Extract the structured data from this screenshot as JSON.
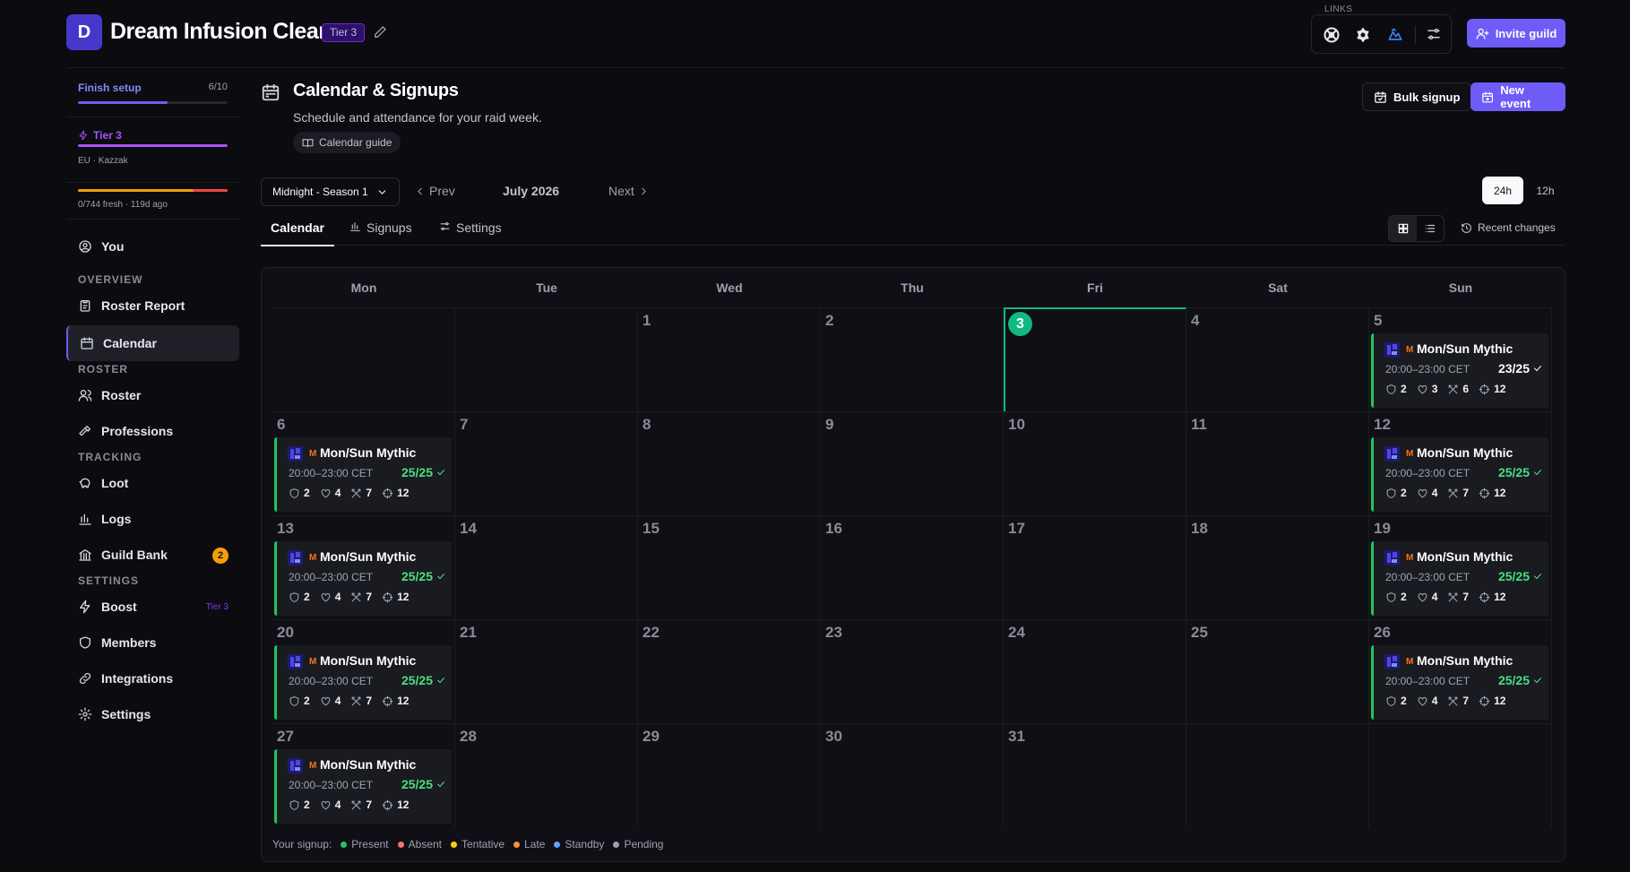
{
  "header": {
    "avatar_letter": "D",
    "guild_name": "Dream Infusion Clean",
    "tier_badge": "Tier 3",
    "links_label": "LINKS",
    "invite_label": "Invite guild",
    "link_icons": [
      "warcraftlogs-icon",
      "raiderio-icon",
      "wowprogress-icon",
      "link-settings-icon"
    ]
  },
  "sidebar": {
    "setup_label": "Finish setup",
    "setup_count": "6/10",
    "setup_progress": 0.6,
    "tier_label": "Tier 3",
    "tier_progress": 1.0,
    "region": "EU · Kazzak",
    "fresh_text": "0/744 fresh · 119d ago",
    "you_label": "You",
    "sections": {
      "overview": "OVERVIEW",
      "roster": "ROSTER",
      "tracking": "TRACKING",
      "settings": "SETTINGS"
    },
    "items": {
      "roster_report": "Roster Report",
      "calendar": "Calendar",
      "roster": "Roster",
      "professions": "Professions",
      "loot": "Loot",
      "logs": "Logs",
      "guild_bank": "Guild Bank",
      "guild_bank_badge": "2",
      "boost": "Boost",
      "boost_tier": "Tier 3",
      "members": "Members",
      "integrations": "Integrations",
      "settings": "Settings"
    }
  },
  "page": {
    "title": "Calendar & Signups",
    "subtitle": "Schedule and attendance for your raid week.",
    "guide_label": "Calendar guide",
    "bulk_signup": "Bulk signup",
    "new_event": "New event"
  },
  "toolbar": {
    "season": "Midnight - Season 1",
    "prev": "Prev",
    "month": "July 2026",
    "next": "Next",
    "fmt_24": "24h",
    "fmt_12": "12h",
    "recent_changes": "Recent changes"
  },
  "tabs": [
    "Calendar",
    "Signups",
    "Settings"
  ],
  "calendar": {
    "weekdays": [
      "Mon",
      "Tue",
      "Wed",
      "Thu",
      "Fri",
      "Sat",
      "Sun"
    ],
    "today": "3",
    "weeks": [
      [
        "",
        "",
        "1",
        "2",
        "3",
        "4",
        "5"
      ],
      [
        "6",
        "7",
        "8",
        "9",
        "10",
        "11",
        "12"
      ],
      [
        "13",
        "14",
        "15",
        "16",
        "17",
        "18",
        "19"
      ],
      [
        "20",
        "21",
        "22",
        "23",
        "24",
        "25",
        "26"
      ],
      [
        "27",
        "28",
        "29",
        "30",
        "31",
        "",
        ""
      ]
    ],
    "events": [
      {
        "week": 0,
        "day": 6,
        "title": "Mon/Sun Mythic",
        "tag": "M",
        "time": "20:00–23:00 CET",
        "count": "23/25",
        "full": false,
        "tanks": "2",
        "healers": "3",
        "melee": "6",
        "ranged": "12"
      },
      {
        "week": 1,
        "day": 0,
        "title": "Mon/Sun Mythic",
        "tag": "M",
        "time": "20:00–23:00 CET",
        "count": "25/25",
        "full": true,
        "tanks": "2",
        "healers": "4",
        "melee": "7",
        "ranged": "12"
      },
      {
        "week": 1,
        "day": 6,
        "title": "Mon/Sun Mythic",
        "tag": "M",
        "time": "20:00–23:00 CET",
        "count": "25/25",
        "full": true,
        "tanks": "2",
        "healers": "4",
        "melee": "7",
        "ranged": "12"
      },
      {
        "week": 2,
        "day": 0,
        "title": "Mon/Sun Mythic",
        "tag": "M",
        "time": "20:00–23:00 CET",
        "count": "25/25",
        "full": true,
        "tanks": "2",
        "healers": "4",
        "melee": "7",
        "ranged": "12"
      },
      {
        "week": 2,
        "day": 6,
        "title": "Mon/Sun Mythic",
        "tag": "M",
        "time": "20:00–23:00 CET",
        "count": "25/25",
        "full": true,
        "tanks": "2",
        "healers": "4",
        "melee": "7",
        "ranged": "12"
      },
      {
        "week": 3,
        "day": 0,
        "title": "Mon/Sun Mythic",
        "tag": "M",
        "time": "20:00–23:00 CET",
        "count": "25/25",
        "full": true,
        "tanks": "2",
        "healers": "4",
        "melee": "7",
        "ranged": "12"
      },
      {
        "week": 3,
        "day": 6,
        "title": "Mon/Sun Mythic",
        "tag": "M",
        "time": "20:00–23:00 CET",
        "count": "25/25",
        "full": true,
        "tanks": "2",
        "healers": "4",
        "melee": "7",
        "ranged": "12"
      },
      {
        "week": 4,
        "day": 0,
        "title": "Mon/Sun Mythic",
        "tag": "M",
        "time": "20:00–23:00 CET",
        "count": "25/25",
        "full": true,
        "tanks": "2",
        "healers": "4",
        "melee": "7",
        "ranged": "12"
      }
    ]
  },
  "legend": {
    "label": "Your signup:",
    "items": [
      {
        "label": "Present",
        "color": "#22c55e"
      },
      {
        "label": "Absent",
        "color": "#f87171"
      },
      {
        "label": "Tentative",
        "color": "#facc15"
      },
      {
        "label": "Late",
        "color": "#fb923c"
      },
      {
        "label": "Standby",
        "color": "#60a5fa"
      },
      {
        "label": "Pending",
        "color": "#9ca3af"
      }
    ]
  },
  "colors": {
    "accent": "#6d5cf6",
    "today": "#10b981",
    "full": "#4ade80"
  }
}
